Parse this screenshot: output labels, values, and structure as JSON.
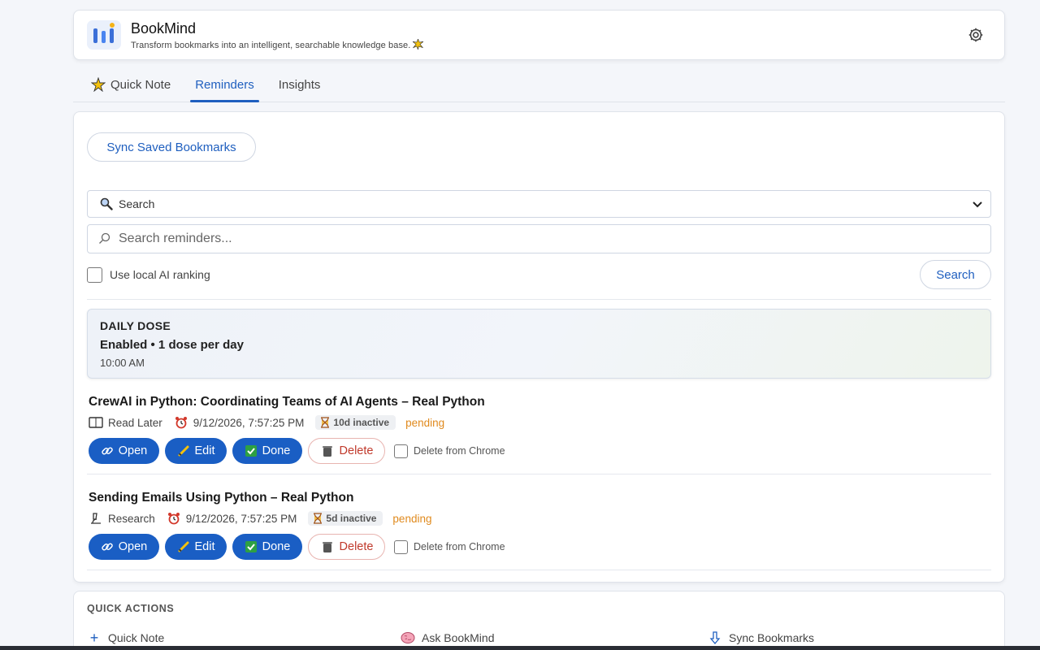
{
  "app": {
    "title": "BookMind",
    "subtitle": "Transform bookmarks into an intelligent, searchable knowledge base."
  },
  "tabs": [
    {
      "label": "Quick Note",
      "icon": "sparkle-star-icon",
      "active": false
    },
    {
      "label": "Reminders",
      "active": true
    },
    {
      "label": "Insights",
      "active": false
    }
  ],
  "reminders": {
    "sync_label": "Sync Saved Bookmarks",
    "mode_select": {
      "selected": "Search"
    },
    "search": {
      "placeholder": "Search reminders..."
    },
    "ai_ranking_label": "Use local AI ranking",
    "search_button": "Search"
  },
  "daily_dose": {
    "heading": "DAILY DOSE",
    "status": "Enabled • 1 dose per day",
    "time": "10:00 AM"
  },
  "items": [
    {
      "title": "CrewAI in Python: Coordinating Teams of AI Agents – Real Python",
      "category": "Read Later",
      "category_icon": "book-icon",
      "datetime": "9/12/2026, 7:57:25 PM",
      "inactive": "10d inactive",
      "status": "pending"
    },
    {
      "title": "Sending Emails Using Python – Real Python",
      "category": "Research",
      "category_icon": "microscope-icon",
      "datetime": "9/12/2026, 7:57:25 PM",
      "inactive": "5d inactive",
      "status": "pending"
    }
  ],
  "item_actions": {
    "open": "Open",
    "edit": "Edit",
    "done": "Done",
    "delete": "Delete",
    "delete_from_chrome": "Delete from Chrome"
  },
  "quick_actions": {
    "title": "QUICK ACTIONS",
    "items": [
      {
        "label": "Quick Note",
        "icon": "plus-icon"
      },
      {
        "label": "Ask BookMind",
        "icon": "brain-icon"
      },
      {
        "label": "Sync Bookmarks",
        "icon": "download-arrow-icon"
      }
    ]
  },
  "colors": {
    "accent": "#1a5ec4",
    "pending": "#e08a1e",
    "danger": "#c0392b"
  }
}
